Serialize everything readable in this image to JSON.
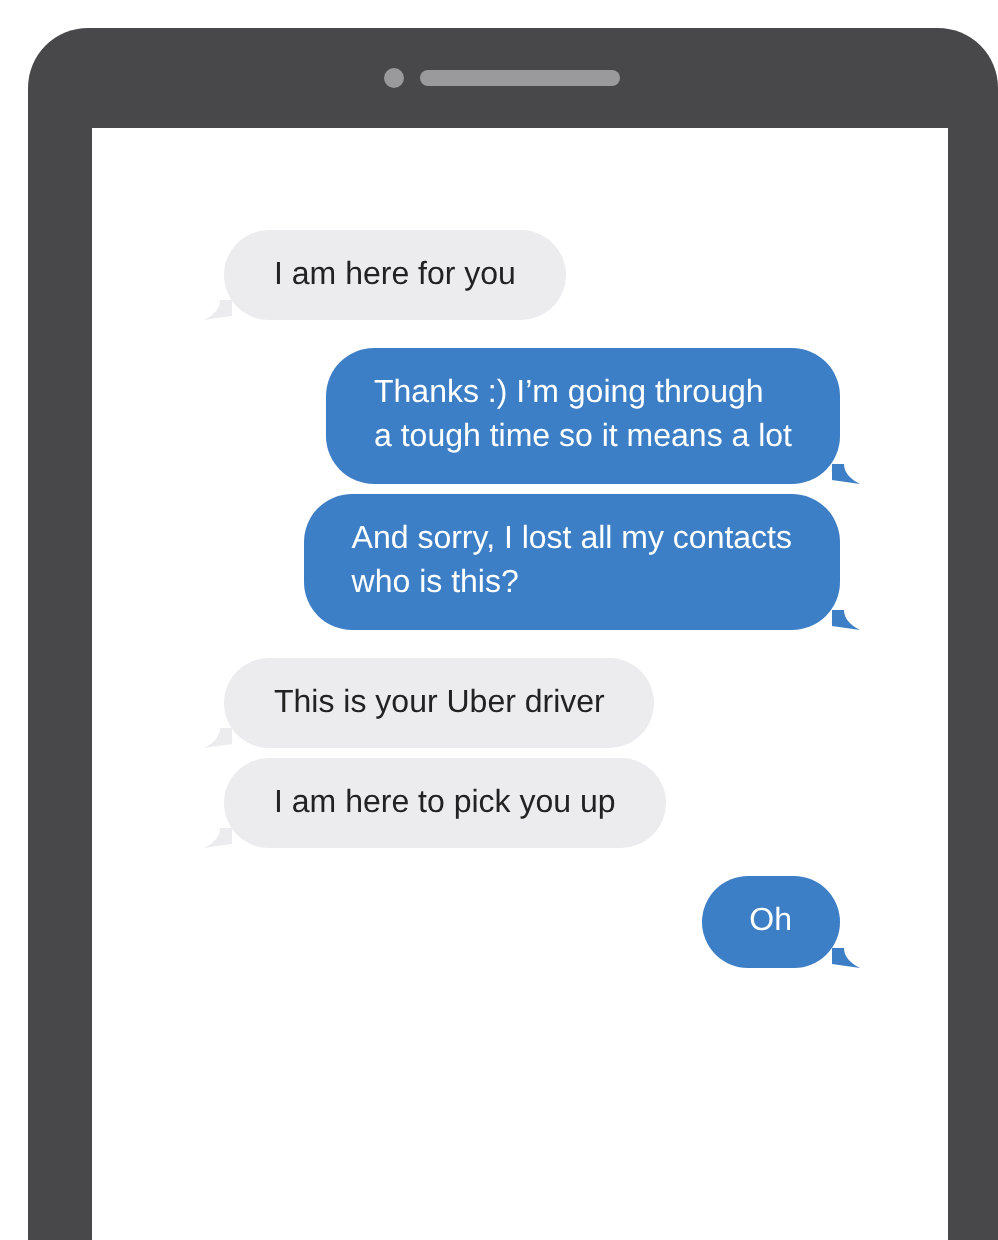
{
  "messages": [
    {
      "kind": "incoming",
      "text": "I am here for you"
    },
    {
      "kind": "outgoing",
      "text": "Thanks :) I’m going through\na tough time so it means a lot"
    },
    {
      "kind": "outgoing",
      "text": "And sorry, I lost all my contacts\nwho is this?"
    },
    {
      "kind": "incoming",
      "text": "This is your Uber driver"
    },
    {
      "kind": "incoming",
      "text": "I am here to pick you up"
    },
    {
      "kind": "outgoing",
      "text": "Oh"
    }
  ]
}
